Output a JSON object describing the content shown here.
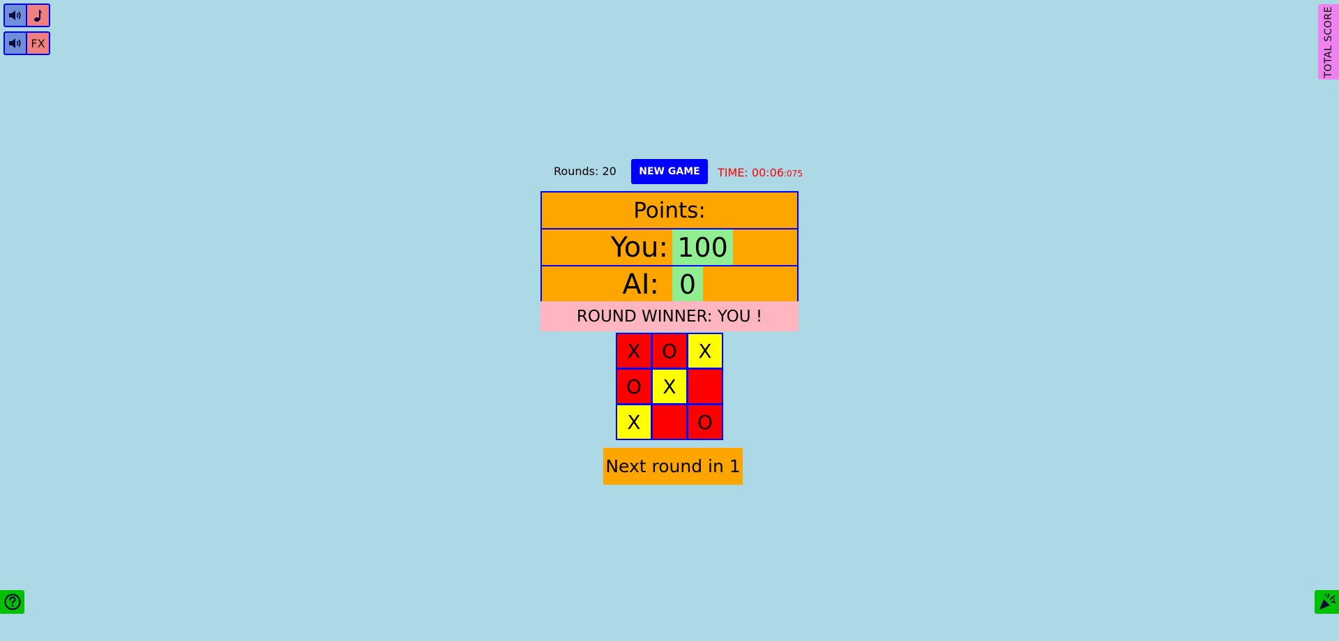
{
  "audio": {
    "music": {
      "speaker_icon": "speaker-icon",
      "kind_icon": "music-note-icon"
    },
    "fx": {
      "speaker_icon": "speaker-icon",
      "label": "FX"
    }
  },
  "total_score_tab": {
    "label": "TOTAL SCORE"
  },
  "header": {
    "rounds_text": "Rounds: 20",
    "new_game_label": "NEW GAME",
    "time_main": "TIME: 00:06",
    "time_ms": ":075"
  },
  "points": {
    "heading": "Points:",
    "you_label": "You:",
    "you_score": "100",
    "ai_label": "AI:",
    "ai_score": "0"
  },
  "round_winner": "ROUND WINNER: YOU !",
  "board": {
    "cells": [
      {
        "mark": "X",
        "color": "#ff0000"
      },
      {
        "mark": "O",
        "color": "#ff0000"
      },
      {
        "mark": "X",
        "color": "#ffff00"
      },
      {
        "mark": "O",
        "color": "#ff0000"
      },
      {
        "mark": "X",
        "color": "#ffff00"
      },
      {
        "mark": "",
        "color": "#ff0000"
      },
      {
        "mark": "X",
        "color": "#ffff00"
      },
      {
        "mark": "",
        "color": "#ff0000"
      },
      {
        "mark": "O",
        "color": "#ff0000"
      }
    ]
  },
  "next_round": "Next round in 1",
  "footer": {
    "help_icon": "help-circle-icon",
    "party_icon": "party-popper-icon"
  },
  "colors": {
    "background": "#add8e6",
    "accent_blue": "#0000ff",
    "panel_orange": "#ffa500",
    "score_green": "#90ee90",
    "winner_pink": "#ffb6c1",
    "timer_red": "#ff0000",
    "tab_violet": "#ee82ee",
    "button_green": "#00c000"
  }
}
